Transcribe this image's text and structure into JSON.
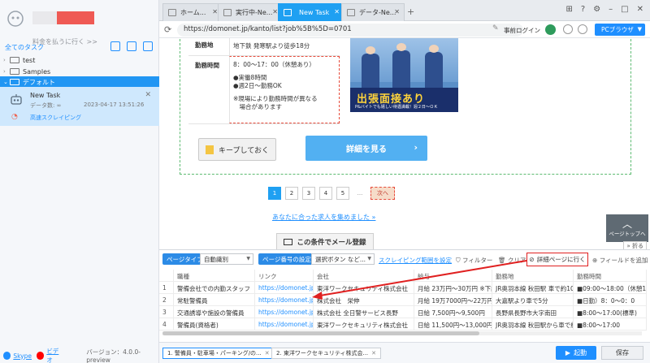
{
  "sidebar": {
    "plan_text": "料金を払うに行く >>",
    "task_header": "全てのタスク",
    "folders": [
      {
        "label": "test",
        "expanded": false
      },
      {
        "label": "Samples",
        "expanded": false
      },
      {
        "label": "デフォルト",
        "expanded": true
      }
    ],
    "task": {
      "name": "New Task",
      "data_label": "データ数: ∞",
      "date": "2023-04-17 13:51:26",
      "speed": "高速スクレイピング"
    },
    "footer": {
      "skype": "Skype",
      "video": "ビデオ",
      "version": "バージョン：4.0.0-preview"
    }
  },
  "tabs": [
    {
      "label": "ホーム..."
    },
    {
      "label": "実行中-Ne..."
    },
    {
      "label": "New Task",
      "active": true
    },
    {
      "label": "データ-Ne..."
    }
  ],
  "address": {
    "url": "https://domonet.jp/kanto/list?job%5B%5D=0701",
    "prelogin": "事前ログイン",
    "browser_mode": "PCブラウザ"
  },
  "page": {
    "rows": [
      {
        "key": "勤務地",
        "lines": [
          "地下鉄 発寒駅より徒歩18分"
        ]
      },
      {
        "key": "勤務時間",
        "lines": [
          "8：00～17：00（休憩あり）",
          "",
          "●実働8時間",
          "●週2日～勤務OK",
          "",
          "※現場により勤務時間が異なる",
          "　場合があります"
        ]
      }
    ],
    "banner_title": "出張面接あり",
    "banner_sub": "P&バイトでも嬉しい待遇満載！週２日〜ＯＫ",
    "keep_button": "キープしておく",
    "detail_button": "詳細を見る",
    "pages": [
      "1",
      "2",
      "3",
      "4",
      "5",
      "..."
    ],
    "next": "次へ",
    "recommend_link": "あなたに合った求人を集めました »",
    "mail_button": "この条件でメール登録",
    "page_top": "ページトップへ",
    "fold": "折る"
  },
  "panel": {
    "page_type_label": "ページタイプ",
    "page_type_value": "自動識別",
    "page_num_label": "ページ番号の設定",
    "page_num_value": "選択ボタン など...",
    "range_link": "スクレイピング範囲を設定",
    "filter": "フィルター",
    "clear": "クリア",
    "goto_detail": "詳細ページに行く",
    "add_field": "フィールドを追加",
    "columns": [
      "",
      "職種",
      "リンク",
      "会社",
      "給与",
      "勤務地",
      "勤務時間"
    ],
    "rows": [
      [
        "1",
        "警備会社での内勤スタッフ",
        "https://domonet.jp/kanto/aid/...",
        "東洋ワークセキュリティ株式会社",
        "月給 23万円～30万円 ※下記...",
        "JR奥羽本線 秋田駅 車で約10分",
        "■09:00～18:00（休憩1時間）"
      ],
      [
        "2",
        "常駐警備員",
        "https://domonet.jp/kanto/aid/...",
        "株式会社　栄伸",
        "月給 19万7000円～22万円",
        "大嘉駅より車で5分",
        "■日勤）8：0～0：0"
      ],
      [
        "3",
        "交通誘導や施設の警備員",
        "https://domonet.jp/kanto/aid/...",
        "株式会社 全日警サービス長野",
        "日給 7,500円～9,500円",
        "長野県長野市大字南田",
        "■8:00～17:00(標準)"
      ],
      [
        "4",
        "警備員(資格者)",
        "https://domonet.jp/kanto/aid/...",
        "東洋ワークセキュリティ株式会社",
        "日給 11,500円～13,000円",
        "JR奥羽本線 秋田駅から車で約9分",
        "■8:00～17:00"
      ]
    ],
    "bottom_tabs": [
      "1. 警備員・駐車場・パーキング/の...",
      "2. 東洋ワークセキュリティ株式会..."
    ],
    "start": "起動",
    "save": "保存"
  },
  "colors": {
    "accent": "#1f8fff",
    "active_tab": "#1fa0f2",
    "annotation": "#e02020"
  }
}
